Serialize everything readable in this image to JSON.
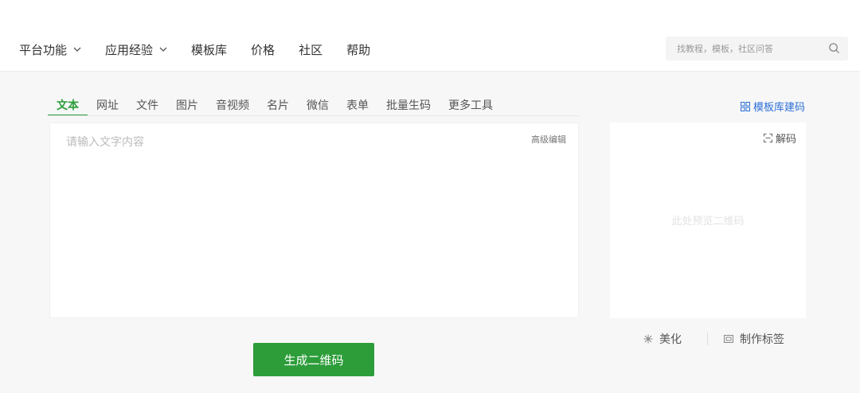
{
  "header": {
    "nav": [
      {
        "label": "平台功能",
        "dropdown": true
      },
      {
        "label": "应用经验",
        "dropdown": true
      },
      {
        "label": "模板库",
        "dropdown": false
      },
      {
        "label": "价格",
        "dropdown": false
      },
      {
        "label": "社区",
        "dropdown": false
      },
      {
        "label": "帮助",
        "dropdown": false
      }
    ],
    "search": {
      "placeholder": "找教程，模板，社区问答",
      "value": "",
      "icon": "search-icon"
    }
  },
  "tabs": {
    "items": [
      "文本",
      "网址",
      "文件",
      "图片",
      "音视频",
      "名片",
      "微信",
      "表单",
      "批量生码",
      "更多工具"
    ],
    "active_index": 0,
    "template_link": {
      "label": "模板库建码",
      "icon": "grid-icon"
    }
  },
  "editor": {
    "placeholder": "请输入文字内容",
    "value": "",
    "advanced_edit": "高级编辑"
  },
  "preview": {
    "decode_label": "解码",
    "decode_icon": "scan-icon",
    "hint": "此处预览二维码"
  },
  "actions": {
    "beautify": {
      "label": "美化",
      "icon": "sparkle-icon"
    },
    "label_make": {
      "label": "制作标签",
      "icon": "label-icon"
    }
  },
  "generate_button": {
    "label": "生成二维码"
  },
  "colors": {
    "accent": "#2d9d3a",
    "link": "#2b6fd6",
    "background": "#f7f7f8"
  }
}
